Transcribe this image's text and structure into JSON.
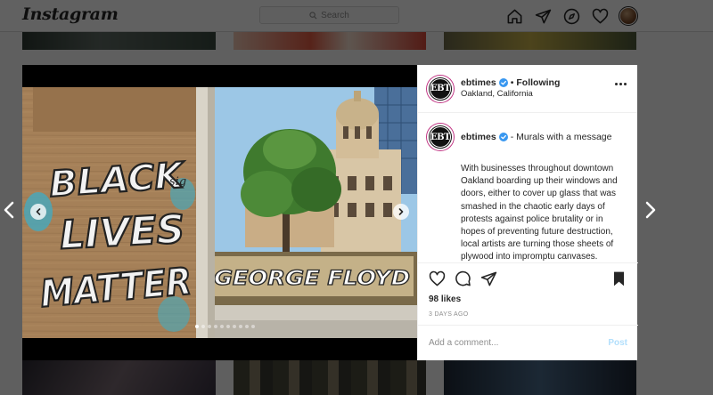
{
  "header": {
    "logo_text": "Instagram",
    "search_placeholder": "Search",
    "icons": [
      "home-icon",
      "direct-message-icon",
      "explore-icon",
      "activity-heart-icon",
      "profile-avatar"
    ]
  },
  "post": {
    "username": "ebtimes",
    "avatar_text": "EBT",
    "separator": "•",
    "follow_status": "Following",
    "location": "Oakland, California",
    "caption_title": "- Murals with a message",
    "caption_body": "With businesses throughout downtown Oakland boarding up their windows and doors, either to cover up glass that was smashed in the chaotic early days of protests against police brutality or in hopes of preventing future destruction, local artists are turning those sheets of plywood into impromptu canvases.",
    "likes": "98 likes",
    "date": "3 DAYS AGO",
    "comment_placeholder": "Add a comment...",
    "post_label": "Post",
    "carousel": {
      "total": 10,
      "active_index": 0
    }
  },
  "media": {
    "mural_left_lines": [
      "BLACK",
      "LIVES",
      "MATTER"
    ],
    "mural_right_text": "GEORGE FLOYD"
  },
  "colors": {
    "verified_blue": "#3897f0",
    "post_button": "#b2dffc",
    "story_ring": "#c13584"
  }
}
